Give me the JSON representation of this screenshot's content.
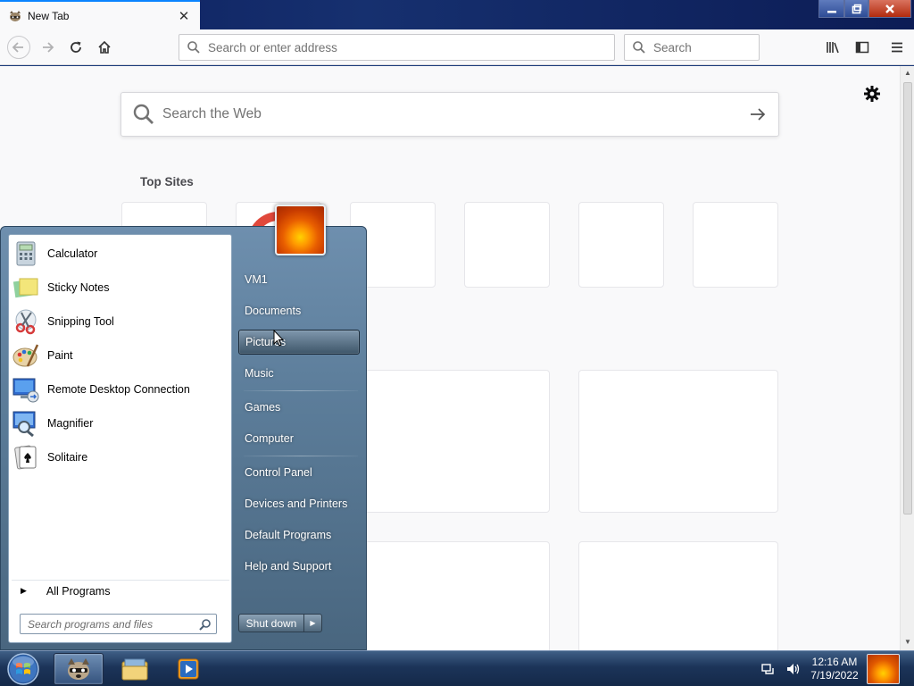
{
  "browser": {
    "tab": {
      "title": "New Tab",
      "favicon": "raccoon-icon",
      "close_icon": "close-icon"
    },
    "window_buttons": {
      "minimize": "minimize-icon",
      "maximize": "restore-icon",
      "close": "close-icon"
    },
    "nav": {
      "back_icon": "back-arrow-icon",
      "forward_icon": "forward-arrow-icon",
      "reload_icon": "reload-icon",
      "home_icon": "home-icon",
      "address_placeholder": "Search or enter address",
      "search_placeholder": "Search",
      "library_icon": "library-icon",
      "sidebar_icon": "sidebar-icon",
      "menu_icon": "hamburger-menu-icon"
    },
    "newtab": {
      "web_search_placeholder": "Search the Web",
      "top_sites_title": "Top Sites"
    }
  },
  "start_menu": {
    "programs": [
      {
        "label": "Calculator",
        "icon": "calculator-icon"
      },
      {
        "label": "Sticky Notes",
        "icon": "sticky-notes-icon"
      },
      {
        "label": "Snipping Tool",
        "icon": "scissors-icon"
      },
      {
        "label": "Paint",
        "icon": "paint-palette-icon"
      },
      {
        "label": "Remote Desktop Connection",
        "icon": "remote-desktop-icon"
      },
      {
        "label": "Magnifier",
        "icon": "magnifier-icon"
      },
      {
        "label": "Solitaire",
        "icon": "playing-card-icon"
      }
    ],
    "all_programs": "All Programs",
    "search_placeholder": "Search programs and files",
    "right_links": [
      {
        "label": "VM1"
      },
      {
        "label": "Documents"
      },
      {
        "label": "Pictures",
        "hovered": true
      },
      {
        "label": "Music"
      },
      {
        "label": "Games"
      },
      {
        "label": "Computer"
      },
      {
        "label": "Control Panel"
      },
      {
        "label": "Devices and Printers"
      },
      {
        "label": "Default Programs"
      },
      {
        "label": "Help and Support"
      }
    ],
    "shutdown_label": "Shut down"
  },
  "taskbar": {
    "pinned": [
      {
        "name": "firefox-raccoon",
        "icon": "raccoon-icon",
        "active": true
      },
      {
        "name": "file-explorer",
        "icon": "folder-icon",
        "active": false
      },
      {
        "name": "media-player",
        "icon": "media-player-icon",
        "active": false
      }
    ],
    "time": "12:16 AM",
    "date": "7/19/2022"
  },
  "colors": {
    "accent": "#0a84ff",
    "taskbar": "#1c3459",
    "start_menu": "#5c7d9a"
  }
}
